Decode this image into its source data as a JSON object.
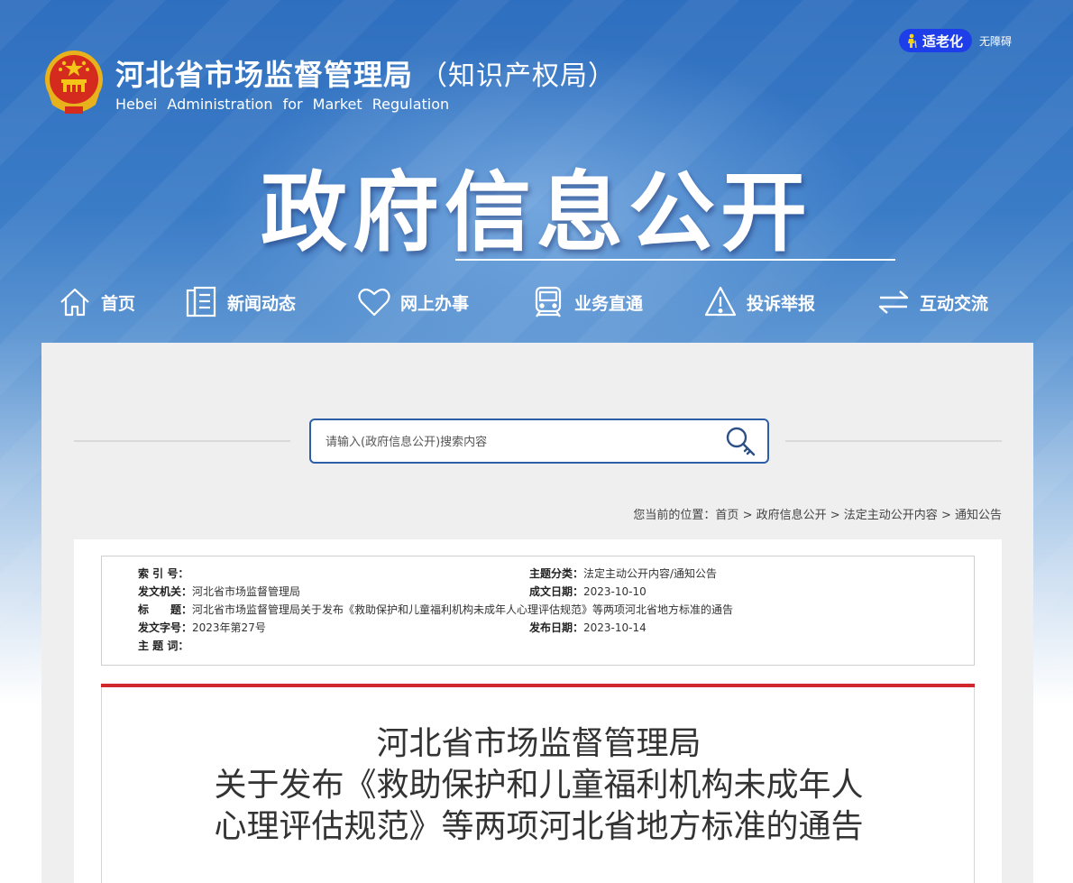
{
  "header": {
    "org_name": "河北省市场监督管理局",
    "org_sub": "（知识产权局）",
    "org_en": "Hebei Administration for Market Regulation",
    "elder_mode": "适老化",
    "accessibility": "无障碍",
    "page_title": "政府信息公开"
  },
  "nav": {
    "items": [
      {
        "label": "首页",
        "icon": "home-icon"
      },
      {
        "label": "新闻动态",
        "icon": "news-icon"
      },
      {
        "label": "网上办事",
        "icon": "heart-icon"
      },
      {
        "label": "业务直通",
        "icon": "train-icon"
      },
      {
        "label": "投诉举报",
        "icon": "warning-icon"
      },
      {
        "label": "互动交流",
        "icon": "exchange-icon"
      }
    ]
  },
  "search": {
    "placeholder": "请输入(政府信息公开)搜索内容",
    "value": ""
  },
  "breadcrumb": {
    "prefix": "您当前的位置：",
    "items": [
      "首页",
      "政府信息公开",
      "法定主动公开内容",
      "通知公告"
    ],
    "sep": " > "
  },
  "meta": {
    "index_label": "索 引 号：",
    "index_value": "",
    "category_label": "主题分类：",
    "category_value": "法定主动公开内容/通知公告",
    "issuer_label": "发文机关：",
    "issuer_value": "河北省市场监督管理局",
    "created_label": "成文日期：",
    "created_value": "2023-10-10",
    "title_label": "标　　题：",
    "title_value": "河北省市场监督管理局关于发布《救助保护和儿童福利机构未成年人心理评估规范》等两项河北省地方标准的通告",
    "docno_label": "发文字号：",
    "docno_value": "2023年第27号",
    "published_label": "发布日期：",
    "published_value": "2023-10-14",
    "keywords_label": "主 题 词：",
    "keywords_value": ""
  },
  "document": {
    "title_lines": [
      "河北省市场监督管理局",
      "关于发布《救助保护和儿童福利机构未成年人",
      "心理评估规范》等两项河北省地方标准的通告"
    ]
  }
}
